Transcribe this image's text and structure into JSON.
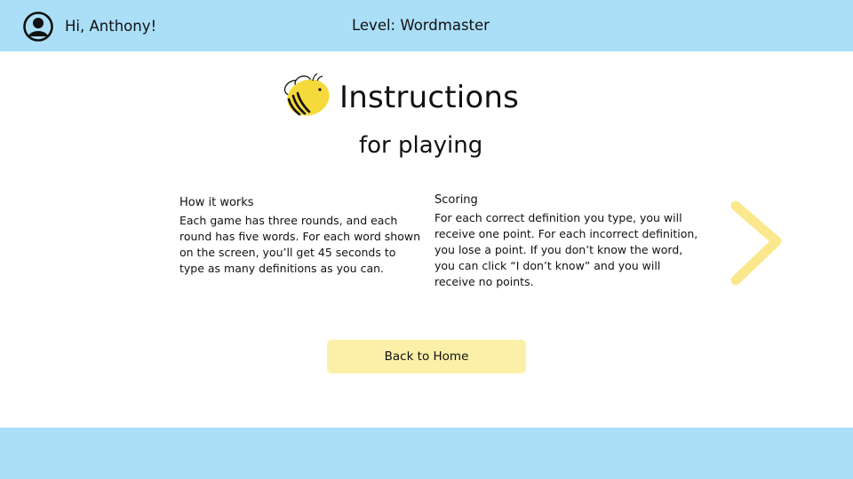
{
  "header": {
    "greeting": "Hi, Anthony!",
    "level": "Level: Wordmaster",
    "avatar_icon": "user-circle-icon"
  },
  "page": {
    "title": "Instructions",
    "subtitle": "for playing",
    "logo_icon": "bee-icon"
  },
  "sections": [
    {
      "heading": "How it works",
      "body": "Each game has three rounds, and each round has five words. For each word shown on the screen, you’ll get 45 seconds to type as many definitions as you can."
    },
    {
      "heading": "Scoring",
      "body": "For each correct definition you type, you will receive one point. For each incorrect definition, you lose a point. If you don’t know the word, you can click “I don’t know” and you will receive no points."
    }
  ],
  "navigation": {
    "next_icon": "chevron-right-icon",
    "back_button_label": "Back to Home"
  },
  "colors": {
    "bar": "#abdff8",
    "button": "#fcf0a8",
    "arrow": "#fbe88d",
    "bee_yellow": "#f6d93a",
    "text": "#111111"
  }
}
